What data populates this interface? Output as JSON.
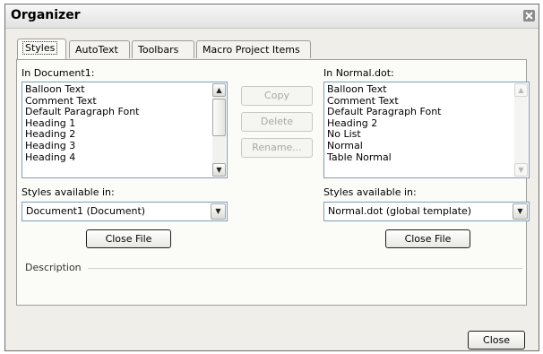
{
  "window": {
    "title": "Organizer",
    "close_icon": "close-icon"
  },
  "tabs": [
    {
      "label": "Styles",
      "active": true
    },
    {
      "label": "AutoText",
      "active": false
    },
    {
      "label": "Toolbars",
      "active": false
    },
    {
      "label": "Macro Project Items",
      "active": false
    }
  ],
  "left": {
    "list_label": "In Document1:",
    "items": [
      "Balloon Text",
      "Comment Text",
      "Default Paragraph Font",
      "Heading 1",
      "Heading 2",
      "Heading 3",
      "Heading 4"
    ],
    "available_label": "Styles available in:",
    "available_value": "Document1 (Document)",
    "close_file_label": "Close File"
  },
  "right": {
    "list_label": "In Normal.dot:",
    "items": [
      "Balloon Text",
      "Comment Text",
      "Default Paragraph Font",
      "Heading 2",
      "No List",
      "Normal",
      "Table Normal"
    ],
    "available_label": "Styles available in:",
    "available_value": "Normal.dot (global template)",
    "close_file_label": "Close File"
  },
  "actions": {
    "copy_label": "Copy",
    "delete_label": "Delete",
    "rename_label": "Rename..."
  },
  "description": {
    "label": "Description",
    "text": ""
  },
  "footer": {
    "close_label": "Close"
  },
  "icons": {
    "scroll_up": "▲",
    "scroll_down": "▼",
    "dropdown": "▼"
  },
  "colors": {
    "dialog_bg": "#efeee8",
    "panel_bg": "#fbfbf8",
    "field_border": "#7f9db9",
    "disabled_text": "#a9a9a4"
  }
}
